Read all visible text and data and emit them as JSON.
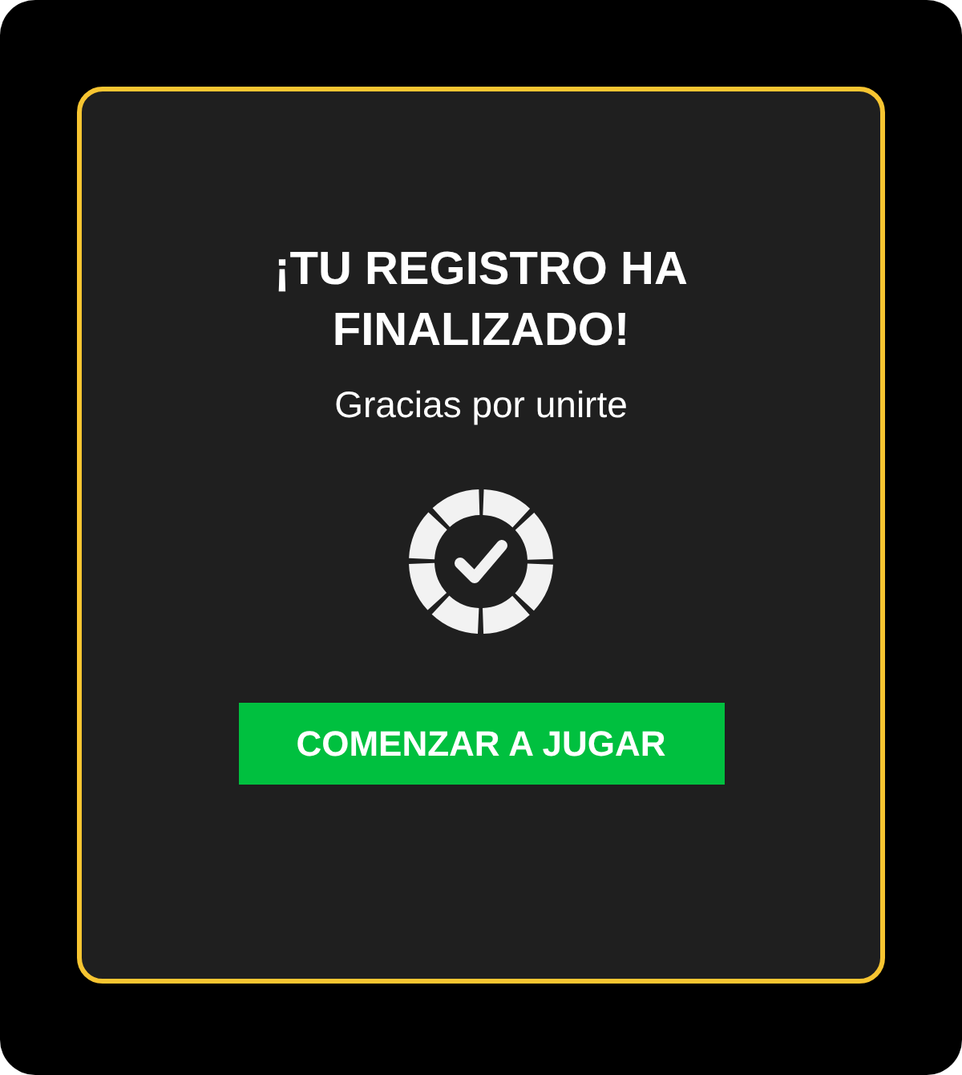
{
  "dialog": {
    "title": "¡TU REGISTRO HA FINALIZADO!",
    "subtitle": "Gracias por unirte",
    "button": "COMENZAR A JUGAR"
  }
}
